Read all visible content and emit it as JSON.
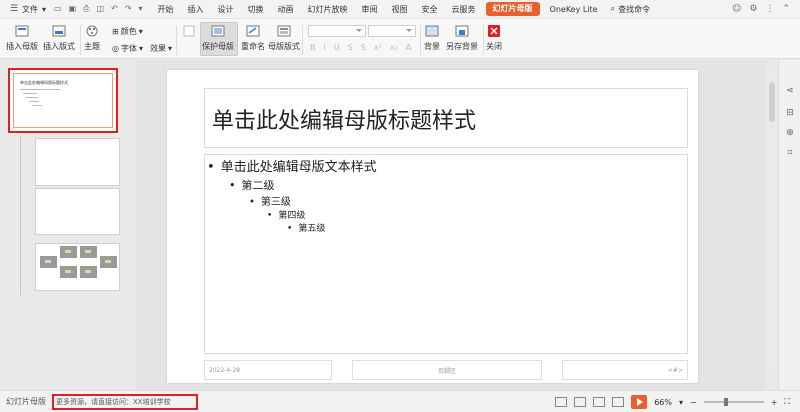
{
  "menu": {
    "file_label": "文件",
    "tabs": [
      "开始",
      "插入",
      "设计",
      "切换",
      "动画",
      "幻灯片放映",
      "审阅",
      "视图",
      "安全",
      "云服务"
    ],
    "active_tab": "幻灯片母版",
    "extra_tab": "OneKey Lite",
    "search_label": "查找命令"
  },
  "ribbon": {
    "insert_master": "插入母版",
    "insert_layout": "插入版式",
    "theme": "主题",
    "color": "颜色",
    "font": "字体",
    "effect": "效果",
    "protect_master": "保护母版",
    "rename": "重命名",
    "master_layout": "母版版式",
    "background": "背景",
    "save_background": "另存背景",
    "close": "关闭"
  },
  "thumbnails": {
    "first_number": "1",
    "first_title": "单击此处编辑母版标题样式"
  },
  "slide": {
    "title": "单击此处编辑母版标题样式",
    "levels": [
      "单击此处编辑母版文本样式",
      "第二级",
      "第三级",
      "第四级",
      "第五级"
    ],
    "footer_date": "2022-4-28",
    "footer_center": "页脚区",
    "footer_number": "<#>"
  },
  "status": {
    "mode": "幻灯片母版",
    "note": "更多资源，请直接访问：XX培训学校",
    "zoom": "66%"
  },
  "colors": {
    "accent": "#e8612c",
    "highlight_red": "#e02020"
  }
}
